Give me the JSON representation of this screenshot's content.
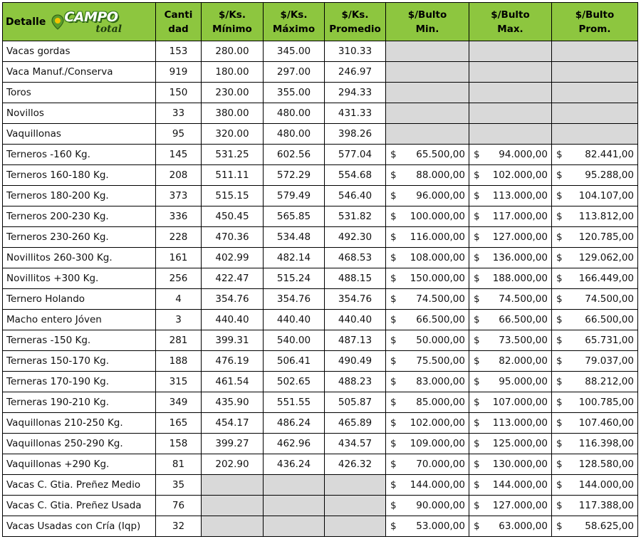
{
  "header": {
    "detalle": "Detalle",
    "logo": {
      "campo": "CAMPO",
      "total": "total"
    },
    "cantidad": [
      "Canti",
      "dad"
    ],
    "kg_min": [
      "$/Ks.",
      "Mínimo"
    ],
    "kg_max": [
      "$/Ks.",
      "Máximo"
    ],
    "kg_prom": [
      "$/Ks.",
      "Promedio"
    ],
    "bulto_min": [
      "$/Bulto",
      "Min."
    ],
    "bulto_max": [
      "$/Bulto",
      "Max."
    ],
    "bulto_prom": [
      "$/Bulto",
      "Prom."
    ]
  },
  "colors": {
    "header_green": "#8dc63f",
    "empty_grey": "#d9d9d9"
  },
  "currency_symbol": "$",
  "rows": [
    {
      "detalle": "Vacas gordas",
      "cantidad": "153",
      "kg_min": "280.00",
      "kg_max": "345.00",
      "kg_prom": "310.33",
      "bulto_min": null,
      "bulto_max": null,
      "bulto_prom": null
    },
    {
      "detalle": "Vaca Manuf./Conserva",
      "cantidad": "919",
      "kg_min": "180.00",
      "kg_max": "297.00",
      "kg_prom": "246.97",
      "bulto_min": null,
      "bulto_max": null,
      "bulto_prom": null
    },
    {
      "detalle": "Toros",
      "cantidad": "150",
      "kg_min": "230.00",
      "kg_max": "355.00",
      "kg_prom": "294.33",
      "bulto_min": null,
      "bulto_max": null,
      "bulto_prom": null
    },
    {
      "detalle": "Novillos",
      "cantidad": "33",
      "kg_min": "380.00",
      "kg_max": "480.00",
      "kg_prom": "431.33",
      "bulto_min": null,
      "bulto_max": null,
      "bulto_prom": null
    },
    {
      "detalle": "Vaquillonas",
      "cantidad": "95",
      "kg_min": "320.00",
      "kg_max": "480.00",
      "kg_prom": "398.26",
      "bulto_min": null,
      "bulto_max": null,
      "bulto_prom": null
    },
    {
      "detalle": "Terneros -160 Kg.",
      "cantidad": "145",
      "kg_min": "531.25",
      "kg_max": "602.56",
      "kg_prom": "577.04",
      "bulto_min": "65.500,00",
      "bulto_max": "94.000,00",
      "bulto_prom": "82.441,00"
    },
    {
      "detalle": "Terneros 160-180 Kg.",
      "cantidad": "208",
      "kg_min": "511.11",
      "kg_max": "572.29",
      "kg_prom": "554.68",
      "bulto_min": "88.000,00",
      "bulto_max": "102.000,00",
      "bulto_prom": "95.288,00"
    },
    {
      "detalle": "Terneros 180-200 Kg.",
      "cantidad": "373",
      "kg_min": "515.15",
      "kg_max": "579.49",
      "kg_prom": "546.40",
      "bulto_min": "96.000,00",
      "bulto_max": "113.000,00",
      "bulto_prom": "104.107,00"
    },
    {
      "detalle": "Terneros 200-230 Kg.",
      "cantidad": "336",
      "kg_min": "450.45",
      "kg_max": "565.85",
      "kg_prom": "531.82",
      "bulto_min": "100.000,00",
      "bulto_max": "117.000,00",
      "bulto_prom": "113.812,00"
    },
    {
      "detalle": "Terneros 230-260 Kg.",
      "cantidad": "228",
      "kg_min": "470.36",
      "kg_max": "534.48",
      "kg_prom": "492.30",
      "bulto_min": "116.000,00",
      "bulto_max": "127.000,00",
      "bulto_prom": "120.785,00"
    },
    {
      "detalle": "Novillitos 260-300 Kg.",
      "cantidad": "161",
      "kg_min": "402.99",
      "kg_max": "482.14",
      "kg_prom": "468.53",
      "bulto_min": "108.000,00",
      "bulto_max": "136.000,00",
      "bulto_prom": "129.062,00"
    },
    {
      "detalle": "Novillitos +300 Kg.",
      "cantidad": "256",
      "kg_min": "422.47",
      "kg_max": "515.24",
      "kg_prom": "488.15",
      "bulto_min": "150.000,00",
      "bulto_max": "188.000,00",
      "bulto_prom": "166.449,00"
    },
    {
      "detalle": "Ternero Holando",
      "cantidad": "4",
      "kg_min": "354.76",
      "kg_max": "354.76",
      "kg_prom": "354.76",
      "bulto_min": "74.500,00",
      "bulto_max": "74.500,00",
      "bulto_prom": "74.500,00"
    },
    {
      "detalle": "Macho entero Jóven",
      "cantidad": "3",
      "kg_min": "440.40",
      "kg_max": "440.40",
      "kg_prom": "440.40",
      "bulto_min": "66.500,00",
      "bulto_max": "66.500,00",
      "bulto_prom": "66.500,00"
    },
    {
      "detalle": "Terneras -150 Kg.",
      "cantidad": "281",
      "kg_min": "399.31",
      "kg_max": "540.00",
      "kg_prom": "487.13",
      "bulto_min": "50.000,00",
      "bulto_max": "73.500,00",
      "bulto_prom": "65.731,00"
    },
    {
      "detalle": "Terneras 150-170 Kg.",
      "cantidad": "188",
      "kg_min": "476.19",
      "kg_max": "506.41",
      "kg_prom": "490.49",
      "bulto_min": "75.500,00",
      "bulto_max": "82.000,00",
      "bulto_prom": "79.037,00"
    },
    {
      "detalle": "Terneras 170-190 Kg.",
      "cantidad": "315",
      "kg_min": "461.54",
      "kg_max": "502.65",
      "kg_prom": "488.23",
      "bulto_min": "83.000,00",
      "bulto_max": "95.000,00",
      "bulto_prom": "88.212,00"
    },
    {
      "detalle": "Terneras 190-210 Kg.",
      "cantidad": "349",
      "kg_min": "435.90",
      "kg_max": "551.55",
      "kg_prom": "505.87",
      "bulto_min": "85.000,00",
      "bulto_max": "107.000,00",
      "bulto_prom": "100.785,00"
    },
    {
      "detalle": "Vaquillonas 210-250 Kg.",
      "cantidad": "165",
      "kg_min": "454.17",
      "kg_max": "486.24",
      "kg_prom": "465.89",
      "bulto_min": "102.000,00",
      "bulto_max": "113.000,00",
      "bulto_prom": "107.460,00"
    },
    {
      "detalle": "Vaquillonas 250-290 Kg.",
      "cantidad": "158",
      "kg_min": "399.27",
      "kg_max": "462.96",
      "kg_prom": "434.57",
      "bulto_min": "109.000,00",
      "bulto_max": "125.000,00",
      "bulto_prom": "116.398,00"
    },
    {
      "detalle": "Vaquillonas +290 Kg.",
      "cantidad": "81",
      "kg_min": "202.90",
      "kg_max": "436.24",
      "kg_prom": "426.32",
      "bulto_min": "70.000,00",
      "bulto_max": "130.000,00",
      "bulto_prom": "128.580,00"
    },
    {
      "detalle": "Vacas C. Gtia. Preñez Medio",
      "cantidad": "35",
      "kg_min": null,
      "kg_max": null,
      "kg_prom": null,
      "bulto_min": "144.000,00",
      "bulto_max": "144.000,00",
      "bulto_prom": "144.000,00"
    },
    {
      "detalle": "Vacas C. Gtia. Preñez Usada",
      "cantidad": "76",
      "kg_min": null,
      "kg_max": null,
      "kg_prom": null,
      "bulto_min": "90.000,00",
      "bulto_max": "127.000,00",
      "bulto_prom": "117.388,00"
    },
    {
      "detalle": "Vacas Usadas con Cría (Iqp)",
      "cantidad": "32",
      "kg_min": null,
      "kg_max": null,
      "kg_prom": null,
      "bulto_min": "53.000,00",
      "bulto_max": "63.000,00",
      "bulto_prom": "58.625,00"
    }
  ]
}
